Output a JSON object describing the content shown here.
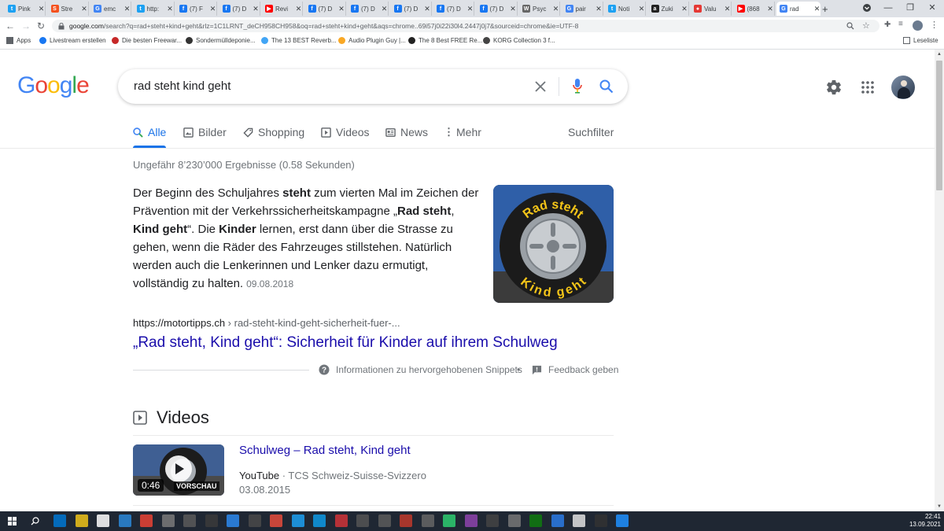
{
  "browser": {
    "tabs": [
      {
        "label": "Pink",
        "color": "#1da1f2",
        "glyph": "t"
      },
      {
        "label": "Stre",
        "color": "#f4511e",
        "glyph": "S"
      },
      {
        "label": "emc",
        "color": "#4285f4",
        "glyph": "G"
      },
      {
        "label": "http:",
        "color": "#1da1f2",
        "glyph": "t"
      },
      {
        "label": "(7) F",
        "color": "#1877f2",
        "glyph": "f"
      },
      {
        "label": "(7) D",
        "color": "#1877f2",
        "glyph": "f"
      },
      {
        "label": "Revi",
        "color": "#ff0000",
        "glyph": "▶"
      },
      {
        "label": "(7) D",
        "color": "#1877f2",
        "glyph": "f"
      },
      {
        "label": "(7) D",
        "color": "#1877f2",
        "glyph": "f"
      },
      {
        "label": "(7) D",
        "color": "#1877f2",
        "glyph": "f"
      },
      {
        "label": "(7) D",
        "color": "#1877f2",
        "glyph": "f"
      },
      {
        "label": "(7) D",
        "color": "#1877f2",
        "glyph": "f"
      },
      {
        "label": "Psyc",
        "color": "#666666",
        "glyph": "W"
      },
      {
        "label": "pair",
        "color": "#4285f4",
        "glyph": "G"
      },
      {
        "label": "Noti",
        "color": "#1da1f2",
        "glyph": "t"
      },
      {
        "label": "Zuki",
        "color": "#222222",
        "glyph": "a"
      },
      {
        "label": "Valu",
        "color": "#e53935",
        "glyph": "●"
      },
      {
        "label": "(868",
        "color": "#ff0000",
        "glyph": "▶"
      },
      {
        "label": "rad",
        "color": "#4285f4",
        "glyph": "G"
      }
    ],
    "url_host": "google.com",
    "url_rest": "/search?q=rad+steht+kind+geht&rlz=1C1LRNT_deCH958CH958&oq=rad+steht+kind+geht&aqs=chrome..69i57j0i22i30l4.2447j0j7&sourceid=chrome&ie=UTF-8",
    "bookmarks": [
      {
        "label": "Apps",
        "color": "#5f6368"
      },
      {
        "label": "Livestream erstellen",
        "color": "#1877f2"
      },
      {
        "label": "Die besten Freewar...",
        "color": "#c62828"
      },
      {
        "label": "Sondermülldeponie...",
        "color": "#333333"
      },
      {
        "label": "The 13 BEST Reverb...",
        "color": "#42a5f5"
      },
      {
        "label": "Audio Plugin Guy |...",
        "color": "#f9a825"
      },
      {
        "label": "The 8 Best FREE Re...",
        "color": "#222222"
      },
      {
        "label": "KORG Collection 3 f...",
        "color": "#444444"
      }
    ],
    "reading_list": "Leseliste"
  },
  "search": {
    "query": "rad steht kind geht",
    "tabs": [
      "Alle",
      "Bilder",
      "Shopping",
      "Videos",
      "News",
      "Mehr"
    ],
    "filter_label": "Suchfilter",
    "stats": "Ungefähr 8’230’000 Ergebnisse (0.58 Sekunden)"
  },
  "featured_snippet": {
    "part1": "Der Beginn des Schuljahres ",
    "b1": "steht",
    "part2": " zum vierten Mal im Zeichen der Prävention mit der Verkehrssicherheitskampagne „",
    "b2": "Rad steht",
    "part3": ", ",
    "b3": "Kind geht",
    "part4": "“. Die ",
    "b4": "Kinder",
    "part5": " lernen, erst dann über die Strasse zu gehen, wenn die Räder des Fahrzeuges stillstehen. Natürlich werden auch die Lenkerinnen und Lenker dazu ermutigt, vollständig zu halten.",
    "date": "09.08.2018",
    "image_text_top": "Rad steht",
    "image_text_bottom": "Kind geht",
    "source_url": "https://motortipps.ch",
    "source_crumb": " › rad-steht-kind-geht-sicherheit-fuer-...",
    "title": "„Rad steht, Kind geht“: Sicherheit für Kinder auf ihrem Schulweg",
    "info_label": "Informationen zu hervorgehobenen Snippets",
    "feedback_label": "Feedback geben"
  },
  "videos": {
    "heading": "Videos",
    "items": [
      {
        "title": "Schulweg – Rad steht, Kind geht",
        "source": "YouTube",
        "channel": "TCS Schweiz-Suisse-Svizzero",
        "date": "03.08.2015",
        "duration": "0:46",
        "preview_label": "VORSCHAU"
      }
    ]
  },
  "taskbar": {
    "time": "22:41",
    "date": "13.09.2021"
  }
}
